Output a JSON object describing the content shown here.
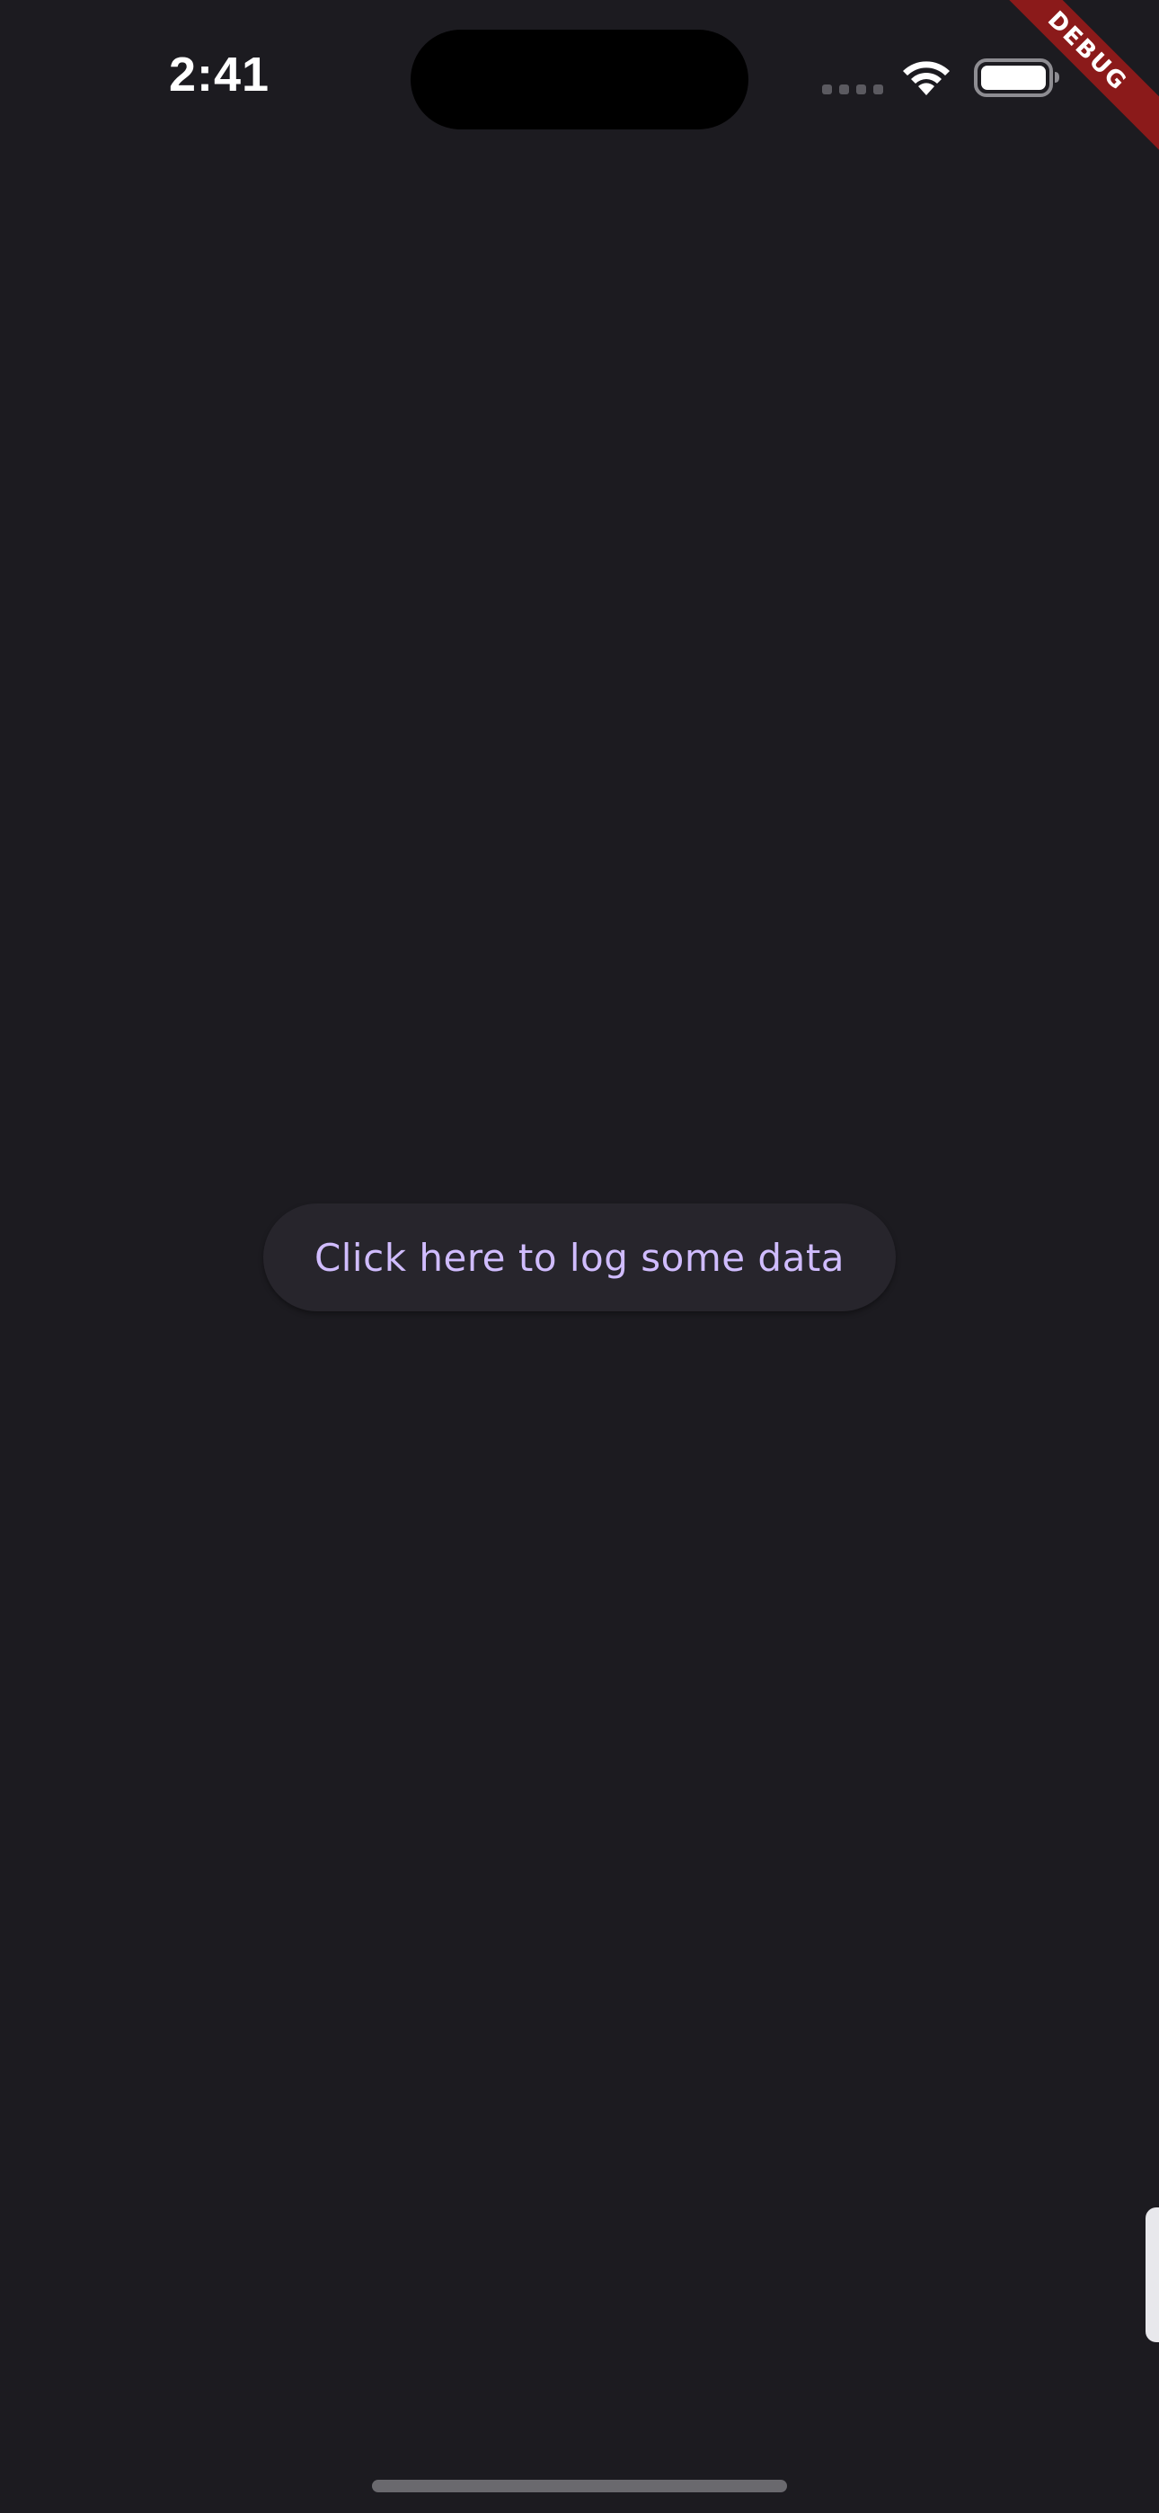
{
  "status_bar": {
    "time": "2:41"
  },
  "debug_banner": {
    "label": "DEBUG",
    "color": "#8b1a1a"
  },
  "main": {
    "log_button_label": "Click here to log some data"
  },
  "colors": {
    "background": "#1c1b20",
    "button_background": "#27252c",
    "button_text": "#d0bcfe"
  }
}
